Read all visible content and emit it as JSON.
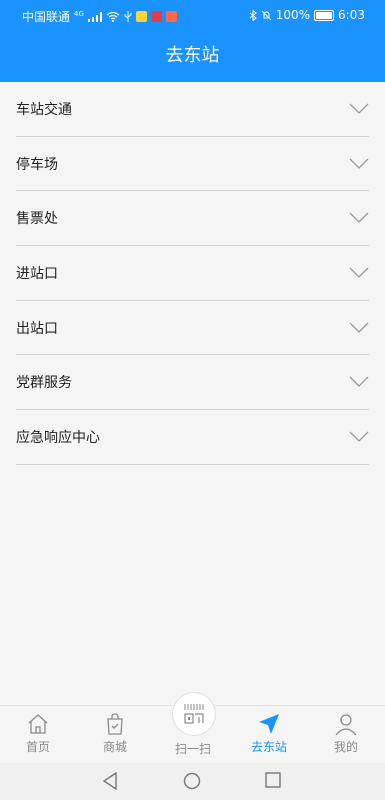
{
  "status": {
    "carrier": "中国联通",
    "network": "4G",
    "battery": "100%",
    "time": "6:03"
  },
  "header": {
    "title": "去东站"
  },
  "sections": [
    {
      "label": "车站交通"
    },
    {
      "label": "停车场"
    },
    {
      "label": "售票处"
    },
    {
      "label": "进站口"
    },
    {
      "label": "出站口"
    },
    {
      "label": "党群服务"
    },
    {
      "label": "应急响应中心"
    }
  ],
  "tabs": [
    {
      "label": "首页",
      "icon": "home-icon"
    },
    {
      "label": "商城",
      "icon": "shopping-bag-icon"
    },
    {
      "label": "扫一扫",
      "icon": "scan-icon"
    },
    {
      "label": "去东站",
      "icon": "navigation-arrow-icon",
      "active": true
    },
    {
      "label": "我的",
      "icon": "user-icon"
    }
  ],
  "colors": {
    "primary": "#1a93ff",
    "divider": "#d3d3d3",
    "inactive": "#8a8a8a"
  }
}
